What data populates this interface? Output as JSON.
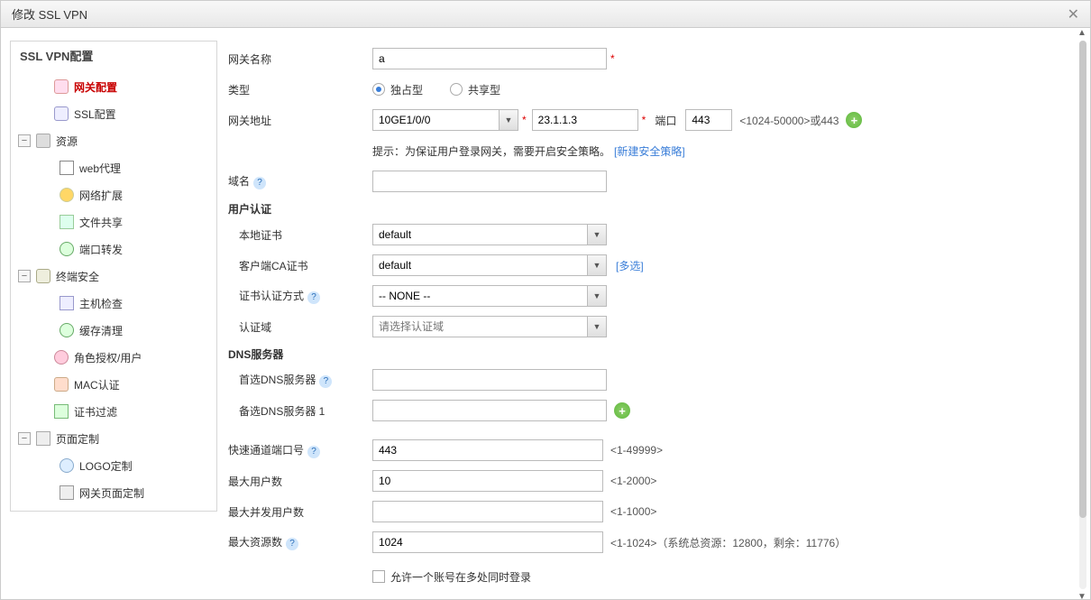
{
  "title": "修改 SSL VPN",
  "sidebar": {
    "header": "SSL VPN配置",
    "items": [
      {
        "label": "网关配置",
        "level": 1,
        "current": true,
        "icon": "ic-globe"
      },
      {
        "label": "SSL配置",
        "level": 1,
        "icon": "ic-ssl"
      },
      {
        "label": "资源",
        "level": 1,
        "expand": true,
        "icon": "ic-folder"
      },
      {
        "label": "web代理",
        "level": 2,
        "icon": "ic-web"
      },
      {
        "label": "网络扩展",
        "level": 2,
        "icon": "ic-net"
      },
      {
        "label": "文件共享",
        "level": 2,
        "icon": "ic-file"
      },
      {
        "label": "端口转发",
        "level": 2,
        "icon": "ic-port"
      },
      {
        "label": "终端安全",
        "level": 1,
        "expand": true,
        "icon": "ic-shield"
      },
      {
        "label": "主机检查",
        "level": 2,
        "icon": "ic-host"
      },
      {
        "label": "缓存清理",
        "level": 2,
        "icon": "ic-clean"
      },
      {
        "label": "角色授权/用户",
        "level": 1,
        "icon": "ic-user"
      },
      {
        "label": "MAC认证",
        "level": 1,
        "icon": "ic-mac"
      },
      {
        "label": "证书过滤",
        "level": 1,
        "icon": "ic-cert"
      },
      {
        "label": "页面定制",
        "level": 1,
        "expand": true,
        "icon": "ic-page"
      },
      {
        "label": "LOGO定制",
        "level": 2,
        "icon": "ic-logo"
      },
      {
        "label": "网关页面定制",
        "level": 2,
        "icon": "ic-gw"
      }
    ]
  },
  "form": {
    "gateway_name_label": "网关名称",
    "gateway_name_value": "a",
    "type_label": "类型",
    "type_options": {
      "exclusive": "独占型",
      "shared": "共享型"
    },
    "gateway_addr_label": "网关地址",
    "interface_value": "10GE1/0/0",
    "ip_value": "23.1.1.3",
    "port_label": "端口",
    "port_value": "443",
    "port_hint": "<1024-50000>或443",
    "addr_tip_prefix": "提示：为保证用户登录网关，需要开启安全策略。",
    "addr_tip_link": "[新建安全策略]",
    "domain_label": "域名",
    "user_auth_section": "用户认证",
    "local_cert_label": "本地证书",
    "local_cert_value": "default",
    "client_ca_label": "客户端CA证书",
    "client_ca_value": "default",
    "client_ca_multi": "[多选]",
    "cert_auth_label": "证书认证方式",
    "cert_auth_value": "-- NONE --",
    "auth_domain_label": "认证域",
    "auth_domain_placeholder": "请选择认证域",
    "dns_section": "DNS服务器",
    "primary_dns_label": "首选DNS服务器",
    "secondary_dns_label": "备选DNS服务器 1",
    "fast_port_label": "快速通道端口号",
    "fast_port_value": "443",
    "fast_port_hint": "<1-49999>",
    "max_users_label": "最大用户数",
    "max_users_value": "10",
    "max_users_hint": "<1-2000>",
    "max_concurrent_label": "最大并发用户数",
    "max_concurrent_hint": "<1-1000>",
    "max_res_label": "最大资源数",
    "max_res_value": "1024",
    "max_res_hint": "<1-1024>（系统总资源：12800，剩余：11776）",
    "allow_multi_login_label": "允许一个账号在多处同时登录"
  }
}
